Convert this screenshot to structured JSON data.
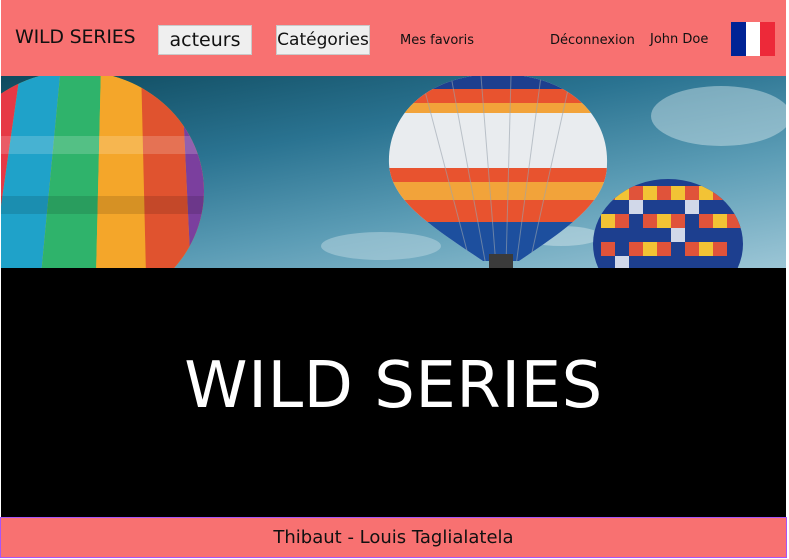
{
  "header": {
    "brand": "WILD SERIES",
    "nav_buttons": [
      {
        "label": "acteurs"
      },
      {
        "label": "Catégories"
      }
    ],
    "links": {
      "favoris": "Mes favoris",
      "deconnexion": "Déconnexion"
    },
    "user_name": "John Doe",
    "language_flag": {
      "icon": "french-flag-icon",
      "colors": [
        "#002395",
        "#ffffff",
        "#ed2939"
      ]
    }
  },
  "hero": {
    "image": "hot-air-balloons-photo"
  },
  "main": {
    "title": "WILD SERIES"
  },
  "footer": {
    "credit": "Thibaut - Louis Taglialatela"
  },
  "colors": {
    "navbar": "#f87171",
    "footer_border": "#a855f7",
    "band": "#000000"
  }
}
